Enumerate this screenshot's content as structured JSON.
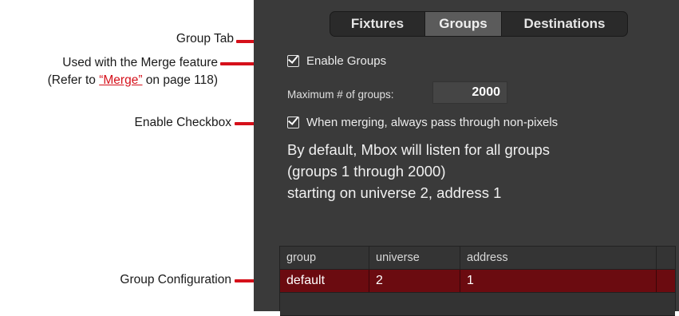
{
  "annotations": {
    "group_tab": "Group Tab",
    "merge_feature": "Used with the Merge feature",
    "refer_prefix": "(Refer to ",
    "refer_link": "“Merge”",
    "refer_suffix": " on page 118)",
    "enable_checkbox": "Enable Checkbox",
    "group_configuration": "Group Configuration"
  },
  "tabs": [
    {
      "label": "Fixtures"
    },
    {
      "label": "Groups",
      "selected": true
    },
    {
      "label": "Destinations"
    }
  ],
  "enable_groups": {
    "label": "Enable Groups",
    "checked": true
  },
  "max_groups": {
    "label": "Maximum # of groups:",
    "value": "2000"
  },
  "pass_through": {
    "label": "When merging, always pass through non-pixels",
    "checked": true
  },
  "info_lines": [
    "By default, Mbox will listen for all groups",
    "(groups 1 through 2000)",
    "starting on universe 2, address 1"
  ],
  "table": {
    "headers": [
      "group",
      "universe",
      "address"
    ],
    "rows": [
      [
        "default",
        "2",
        "1"
      ]
    ]
  },
  "colors": {
    "accent": "#d5101a",
    "panel": "#3a3a3a",
    "selected_row": "#6b0b10"
  }
}
